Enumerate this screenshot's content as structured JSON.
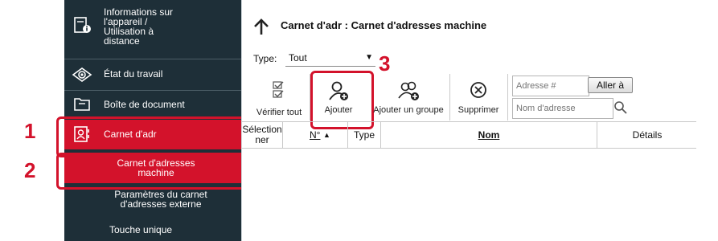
{
  "sidebar": {
    "items": [
      {
        "label": "Informations sur l'appareil / Utilisation à distance",
        "lines": [
          "Informations sur",
          "l'appareil /",
          "Utilisation à",
          "distance"
        ],
        "icon": "device-info-icon"
      },
      {
        "label": "État du travail",
        "icon": "eye-icon"
      },
      {
        "label": "Boîte de document",
        "icon": "folder-icon"
      },
      {
        "label": "Carnet d'adr",
        "icon": "address-book-icon",
        "selected": true
      },
      {
        "label": "Carnet d'adresses machine",
        "lines": [
          "Carnet d'adresses",
          "machine"
        ],
        "selected": true,
        "sub": true
      },
      {
        "label": "Paramètres du carnet d'adresses externe",
        "lines": [
          "Paramètres du carnet",
          "d'adresses externe"
        ],
        "sub": true
      },
      {
        "label": "Touche unique",
        "sub": true
      }
    ]
  },
  "callouts": {
    "step1": "1",
    "step2": "2",
    "step3": "3"
  },
  "header": {
    "title": "Carnet d'adr : Carnet d'adresses machine",
    "back_icon": "arrow-up-icon"
  },
  "filter": {
    "label": "Type:",
    "value": "Tout"
  },
  "toolbar": {
    "verify_all": "Vérifier tout",
    "add": "Ajouter",
    "add_group": "Ajouter un groupe",
    "delete": "Supprimer"
  },
  "search": {
    "number_placeholder": "Adresse #",
    "go_label": "Aller à",
    "name_placeholder": "Nom d'adresse"
  },
  "table": {
    "columns": {
      "select": "Sélection ner",
      "select_lines": [
        "Sélection",
        "ner"
      ],
      "number": "N°",
      "type": "Type",
      "name": "Nom",
      "details": "Détails"
    }
  },
  "colors": {
    "sidebar_bg": "#1e2f38",
    "accent_red": "#d3122b",
    "main_bg": "#ffffff"
  }
}
